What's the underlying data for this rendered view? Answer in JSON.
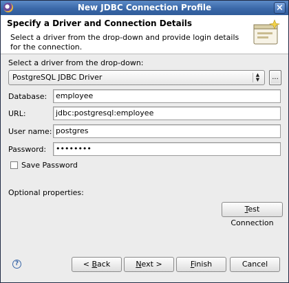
{
  "window": {
    "title": "New JDBC Connection Profile"
  },
  "header": {
    "title": "Specify a Driver and Connection Details",
    "description": "Select a driver from the drop-down and provide login details for the connection."
  },
  "driver": {
    "label": "Select a driver from the drop-down:",
    "selected": "PostgreSQL JDBC Driver",
    "browse_label": "..."
  },
  "fields": {
    "database": {
      "label": "Database:",
      "value": "employee"
    },
    "url": {
      "label": "URL:",
      "value": "jdbc:postgresql:employee"
    },
    "user": {
      "label": "User name:",
      "value": "postgres"
    },
    "password": {
      "label": "Password:",
      "value": "••••••••"
    }
  },
  "save_password": {
    "label": "Save Password",
    "checked": false
  },
  "optional": {
    "label": "Optional properties:"
  },
  "test_connection": {
    "label_pre": "",
    "mnemonic": "T",
    "label_post": "est Connection"
  },
  "footer": {
    "back": {
      "label_pre": "< ",
      "mnemonic": "B",
      "label_post": "ack"
    },
    "next": {
      "label_pre": "",
      "mnemonic": "N",
      "label_post": "ext >"
    },
    "finish": {
      "label_pre": "",
      "mnemonic": "F",
      "label_post": "inish"
    },
    "cancel": {
      "label_pre": "",
      "mnemonic": "",
      "label_post": "Cancel"
    }
  },
  "icons": {
    "app": "eclipse-icon",
    "close": "close-icon",
    "banner": "connection-wizard-icon",
    "help": "help-icon",
    "dropdown": "chevron-updown-icon"
  }
}
